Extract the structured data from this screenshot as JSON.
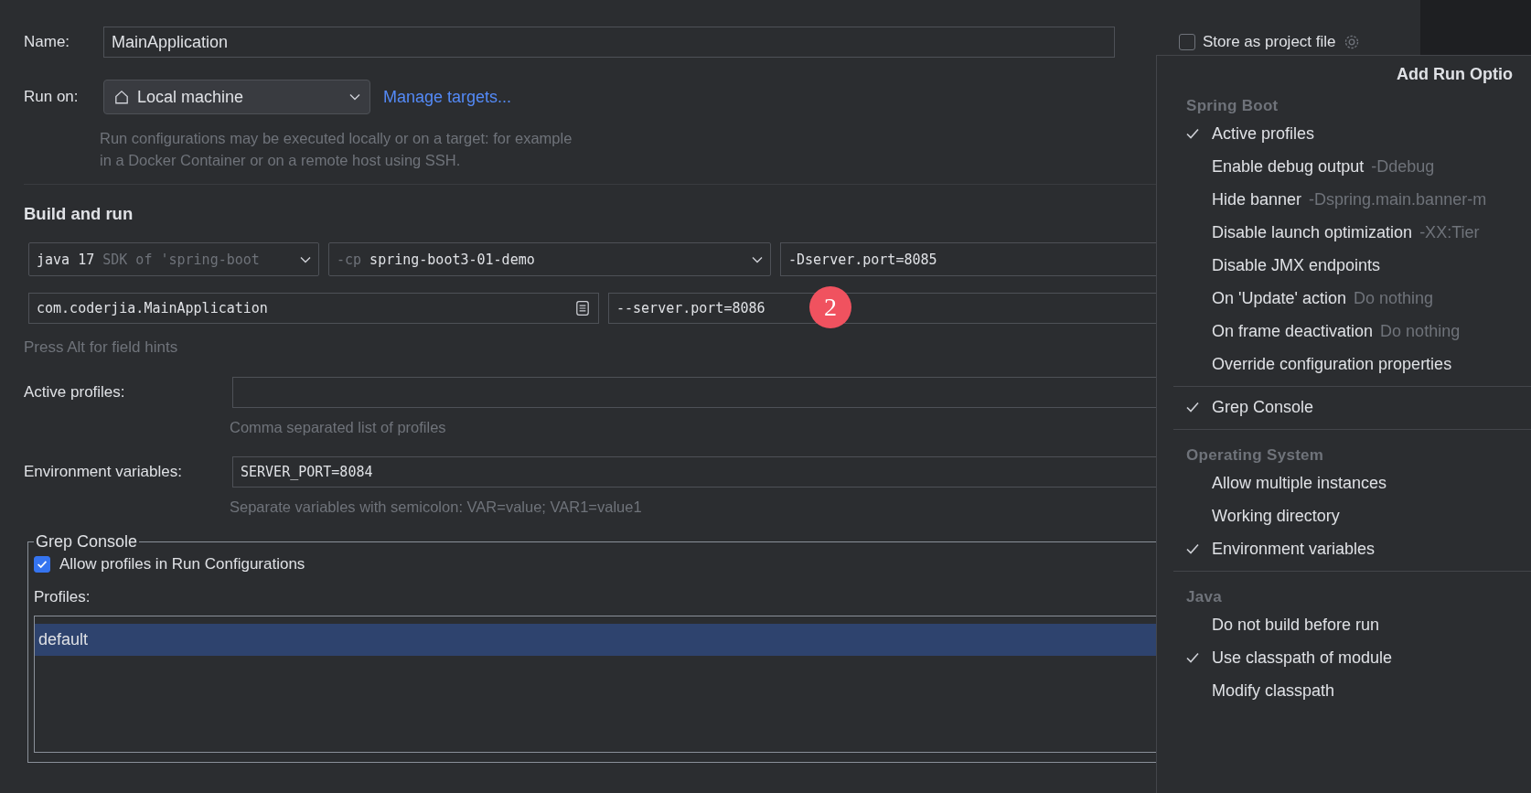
{
  "header": {
    "name_label": "Name:",
    "name_value": "MainApplication",
    "store_as_project_file": {
      "label": "Store as project file",
      "checked": false
    }
  },
  "run_on": {
    "label": "Run on:",
    "value": "Local machine",
    "link": "Manage targets...",
    "hint": "Run configurations may be executed locally or on a target: for example in a Docker Container or on a remote host using SSH."
  },
  "build_and_run": {
    "title": "Build and run",
    "sdk": {
      "value": "java 17",
      "detail": "SDK of 'spring-boot"
    },
    "classpath": {
      "prefix": "-cp",
      "value": "spring-boot3-01-demo"
    },
    "vm_options": "-Dserver.port=8085",
    "main_class": "com.coderjia.MainApplication",
    "program_arguments": "--server.port=8086",
    "hint": "Press Alt for field hints"
  },
  "active_profiles": {
    "label": "Active profiles:",
    "hint": "Comma separated list of profiles"
  },
  "environment_variables": {
    "label": "Environment variables:",
    "value": "SERVER_PORT=8084",
    "hint": "Separate variables with semicolon: VAR=value; VAR1=value1"
  },
  "grep_console": {
    "title": "Grep Console",
    "allow_profiles": {
      "label": "Allow profiles in Run Configurations",
      "checked": true
    },
    "profiles_label": "Profiles:",
    "profiles": [
      {
        "name": "default",
        "selected": true
      }
    ]
  },
  "annotation_badge": "2",
  "menu": {
    "title": "Add Run Optio",
    "sections": [
      {
        "title": "Spring Boot",
        "items": [
          {
            "label": "Active profiles",
            "checked": true
          },
          {
            "label": "Enable debug output",
            "hint": "-Ddebug",
            "checked": false
          },
          {
            "label": "Hide banner",
            "hint": "-Dspring.main.banner-m",
            "checked": false
          },
          {
            "label": "Disable launch optimization",
            "hint": "-XX:Tier",
            "checked": false
          },
          {
            "label": "Disable JMX endpoints",
            "checked": false
          },
          {
            "label": "On 'Update' action",
            "hint": "Do nothing",
            "checked": false
          },
          {
            "label": "On frame deactivation",
            "hint": "Do nothing",
            "checked": false
          },
          {
            "label": "Override configuration properties",
            "checked": false
          }
        ]
      },
      {
        "items": [
          {
            "label": "Grep Console",
            "checked": true
          }
        ]
      },
      {
        "title": "Operating System",
        "items": [
          {
            "label": "Allow multiple instances",
            "checked": false
          },
          {
            "label": "Working directory",
            "checked": false
          },
          {
            "label": "Environment variables",
            "checked": true
          }
        ]
      },
      {
        "title": "Java",
        "items": [
          {
            "label": "Do not build before run",
            "checked": false
          },
          {
            "label": "Use classpath of module",
            "checked": true
          },
          {
            "label": "Modify classpath",
            "checked": false
          }
        ]
      }
    ]
  }
}
